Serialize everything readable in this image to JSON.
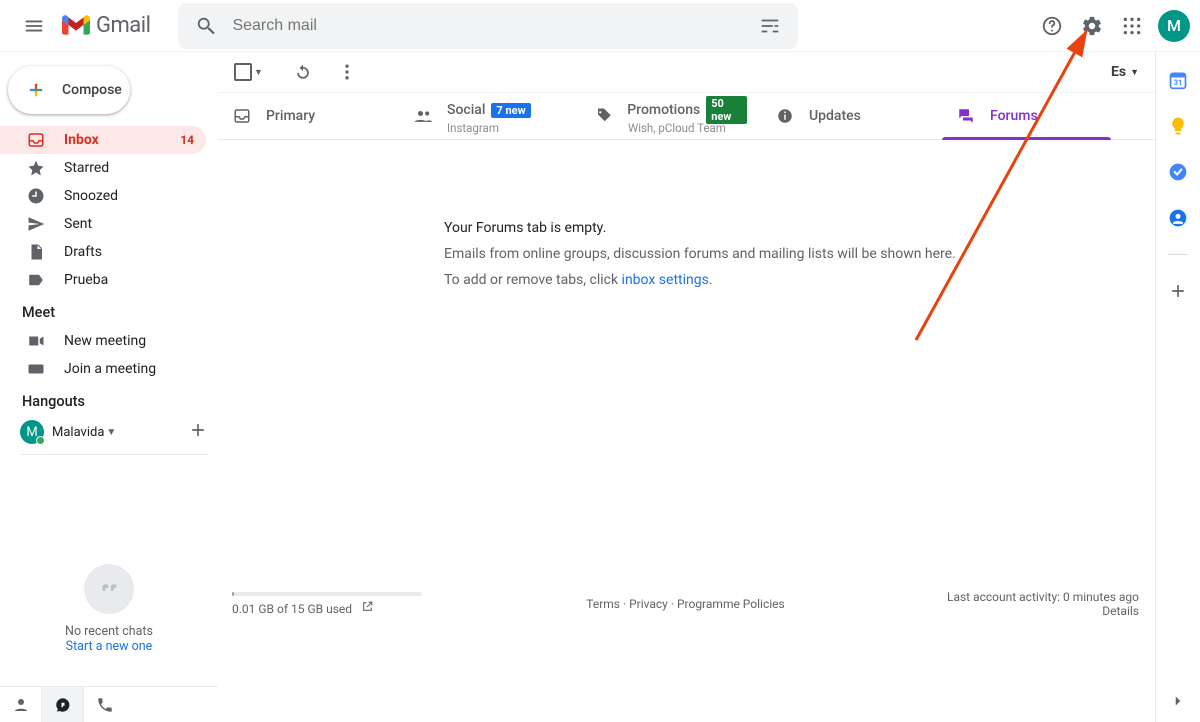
{
  "header": {
    "logo_text": "Gmail",
    "search_placeholder": "Search mail",
    "avatar_initial": "M"
  },
  "compose_label": "Compose",
  "sidebar": {
    "items": [
      {
        "label": "Inbox",
        "count": "14"
      },
      {
        "label": "Starred"
      },
      {
        "label": "Snoozed"
      },
      {
        "label": "Sent"
      },
      {
        "label": "Drafts"
      },
      {
        "label": "Prueba"
      }
    ]
  },
  "meet": {
    "title": "Meet",
    "new_meeting": "New meeting",
    "join_meeting": "Join a meeting"
  },
  "hangouts": {
    "title": "Hangouts",
    "user_name": "Malavida",
    "avatar_initial": "M",
    "no_chats": "No recent chats",
    "start_new": "Start a new one"
  },
  "toolbar": {
    "input_tools": "Es"
  },
  "tabs": {
    "primary": "Primary",
    "social": "Social",
    "social_badge": "7 new",
    "social_sub": "Instagram",
    "promotions": "Promotions",
    "promotions_badge": "50 new",
    "promotions_sub": "Wish, pCloud Team",
    "updates": "Updates",
    "forums": "Forums"
  },
  "empty": {
    "line1": "Your Forums tab is empty.",
    "line2": "Emails from online groups, discussion forums and mailing lists will be shown here.",
    "line3_pre": "To add or remove tabs, click ",
    "line3_link": "inbox settings",
    "line3_post": "."
  },
  "footer": {
    "storage": "0.01 GB of 15 GB used",
    "terms": "Terms",
    "privacy": "Privacy",
    "policies": "Programme Policies",
    "activity": "Last account activity: 0 minutes ago",
    "details": "Details",
    "sep": " · "
  }
}
